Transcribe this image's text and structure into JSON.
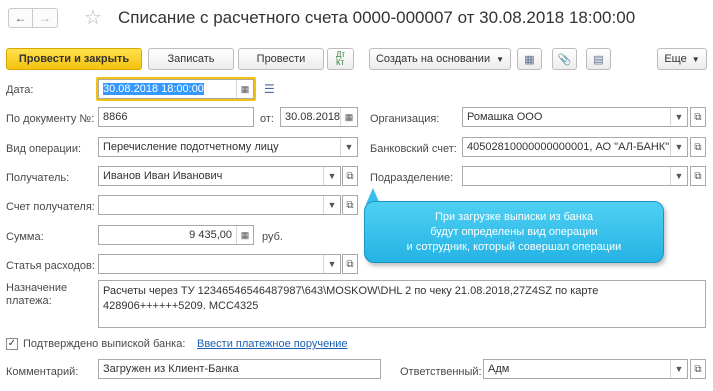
{
  "header": {
    "title": "Списание с расчетного счета 0000-000007 от 30.08.2018 18:00:00"
  },
  "toolbar": {
    "post_close": "Провести и закрыть",
    "write": "Записать",
    "post": "Провести",
    "dtkt": "Дт\nКт",
    "create_base": "Создать на основании",
    "more": "Еще"
  },
  "form": {
    "date_label": "Дата:",
    "date_value": "30.08.2018 18:00:00",
    "doc_no_label": "По документу №:",
    "doc_no_value": "8866",
    "from_label": "от:",
    "from_value": "30.08.2018",
    "operation_label": "Вид операции:",
    "operation_value": "Перечисление подотчетному лицу",
    "recipient_label": "Получатель:",
    "recipient_value": "Иванов Иван Иванович",
    "recipient_account_label": "Счет получателя:",
    "recipient_account_value": "",
    "amount_label": "Сумма:",
    "amount_value": "9 435,00",
    "currency": "руб.",
    "expense_label": "Статья расходов:",
    "expense_value": "",
    "org_label": "Организация:",
    "org_value": "Ромашка ООО",
    "bank_label": "Банковский счет:",
    "bank_value": "40502810000000000001, АО \"АЛ-БАНК\"",
    "division_label": "Подразделение:",
    "division_value": "",
    "purpose_label_1": "Назначение",
    "purpose_label_2": "платежа:",
    "purpose_line_1": "Расчеты через ТУ 12346546546487987\\643\\MOSKOW\\DHL 2 по чеку 21.08.2018,27Z4SZ по карте",
    "purpose_line_2": "428906++++++5209. MCC4325",
    "confirmed_label": "Подтверждено выпиской банка:",
    "enter_order_link": "Ввести платежное поручение",
    "comment_label": "Комментарий:",
    "comment_value": "Загружен из Клиент-Банка",
    "responsible_label": "Ответственный:",
    "responsible_value": "Адм"
  },
  "tooltip": {
    "line1": "При загрузке выписки из банка",
    "line2": "будут определены вид операции",
    "line3": "и сотрудник, который совершал операции"
  },
  "colors": {
    "primary_button": "#f4c20d",
    "tooltip": "#2bb6e6",
    "link": "#1d5fb0"
  }
}
